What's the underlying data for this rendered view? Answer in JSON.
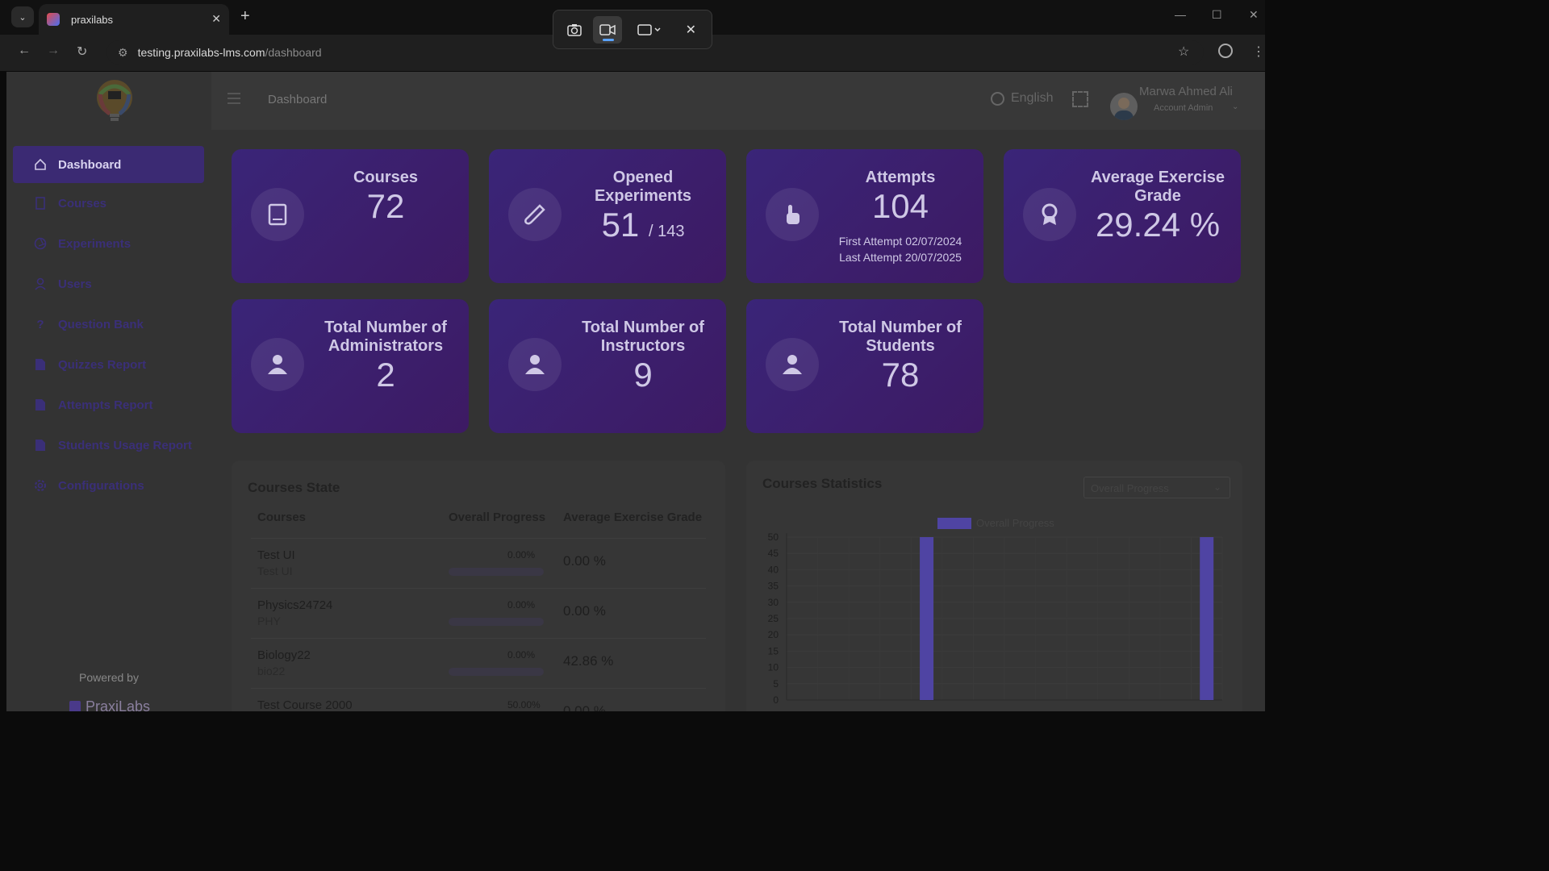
{
  "browser": {
    "tab_title": "praxilabs",
    "url_host": "testing.praxilabs-lms.com",
    "url_path": "/dashboard"
  },
  "header": {
    "breadcrumb": "Dashboard",
    "language": "English",
    "user_name": "Marwa Ahmed Ali",
    "user_role": "Account Admin"
  },
  "sidebar": {
    "items": [
      {
        "label": "Dashboard",
        "icon": "home-icon"
      },
      {
        "label": "Courses",
        "icon": "book-icon"
      },
      {
        "label": "Experiments",
        "icon": "aperture-icon"
      },
      {
        "label": "Users",
        "icon": "user-icon"
      },
      {
        "label": "Question Bank",
        "icon": "question-icon"
      },
      {
        "label": "Quizzes Report",
        "icon": "report-icon"
      },
      {
        "label": "Attempts Report",
        "icon": "report-icon"
      },
      {
        "label": "Students Usage Report",
        "icon": "report-icon"
      },
      {
        "label": "Configurations",
        "icon": "gear-icon"
      }
    ],
    "powered_by": "Powered by",
    "brand": "PraxiLabs"
  },
  "cards": {
    "courses": {
      "title": "Courses",
      "value": "72"
    },
    "experiments": {
      "title": "Opened Experiments",
      "value": "51",
      "total": "/ 143"
    },
    "attempts": {
      "title": "Attempts",
      "value": "104",
      "first": "First Attempt 02/07/2024",
      "last": "Last Attempt 20/07/2025"
    },
    "grade": {
      "title": "Average Exercise Grade",
      "value": "29.24 %"
    },
    "admins": {
      "title": "Total Number of Administrators",
      "value": "2"
    },
    "instructors": {
      "title": "Total Number of Instructors",
      "value": "9"
    },
    "students": {
      "title": "Total Number of Students",
      "value": "78"
    }
  },
  "courses_state": {
    "title": "Courses State",
    "headers": [
      "Courses",
      "Overall Progress",
      "Average Exercise Grade"
    ],
    "rows": [
      {
        "name": "Test UI",
        "code": "Test UI",
        "progress": "0.00%",
        "progress_value": 0,
        "grade": "0.00 %"
      },
      {
        "name": "Physics24724",
        "code": "PHY",
        "progress": "0.00%",
        "progress_value": 0,
        "grade": "0.00 %"
      },
      {
        "name": "Biology22",
        "code": "bio22",
        "progress": "0.00%",
        "progress_value": 0,
        "grade": "42.86 %"
      },
      {
        "name": "Test Course 2000",
        "code": "",
        "progress": "50.00%",
        "progress_value": 50,
        "grade": "0.00 %"
      }
    ]
  },
  "courses_statistics": {
    "title": "Courses Statistics",
    "select_value": "Overall Progress",
    "legend": "Overall Progress"
  },
  "chart_data": {
    "type": "bar",
    "series": [
      {
        "name": "Overall Progress",
        "values": [
          0,
          0,
          0,
          0,
          50,
          0,
          0,
          0,
          0,
          0,
          0,
          0,
          0,
          50
        ]
      }
    ],
    "ylim": [
      0,
      50
    ],
    "yticks": [
      "0",
      "5",
      "10",
      "15",
      "20",
      "25",
      "30",
      "35",
      "40",
      "45",
      "50"
    ],
    "grid": true,
    "legend_position": "top"
  },
  "colors": {
    "accent": "#3b2a73",
    "bar": "#4f44a3"
  }
}
